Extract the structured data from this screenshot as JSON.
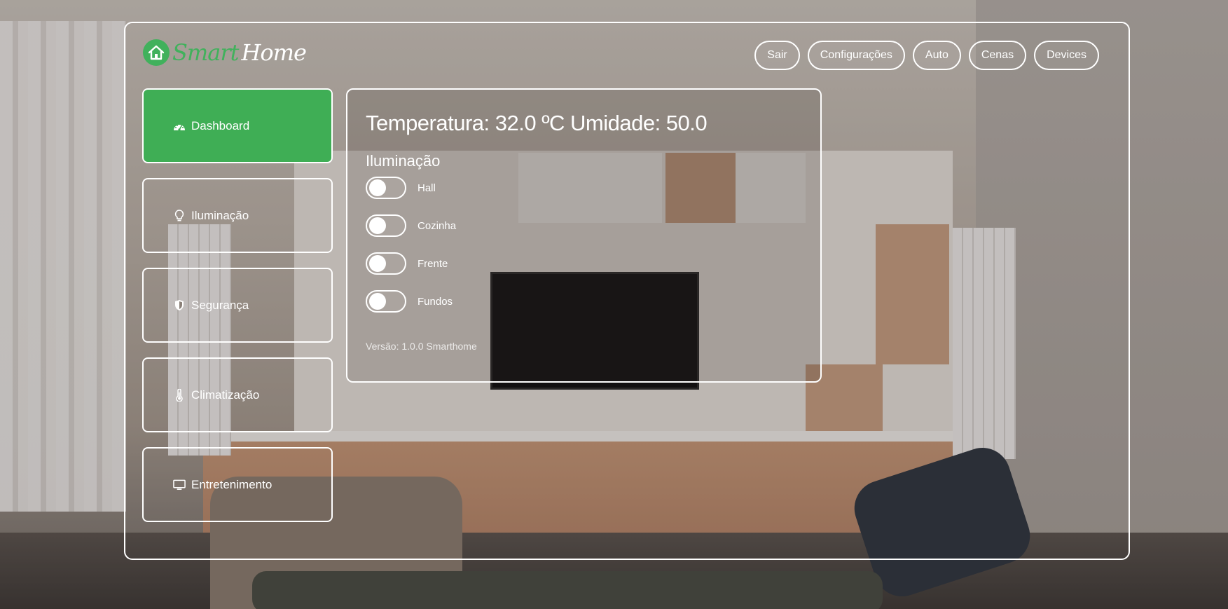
{
  "brand": {
    "smart": "Smart",
    "home": "Home",
    "icon": "house-icon",
    "accent": "#41b15c"
  },
  "topnav": {
    "items": [
      {
        "label": "Sair"
      },
      {
        "label": "Configurações"
      },
      {
        "label": "Auto"
      },
      {
        "label": "Cenas"
      },
      {
        "label": "Devices"
      }
    ]
  },
  "sidebar": {
    "items": [
      {
        "label": "Dashboard",
        "icon": "speedometer-icon",
        "active": true
      },
      {
        "label": "Iluminação",
        "icon": "lightbulb-icon"
      },
      {
        "label": "Segurança",
        "icon": "shield-icon"
      },
      {
        "label": "Climatização",
        "icon": "thermometer-icon"
      },
      {
        "label": "Entretenimento",
        "icon": "monitor-icon"
      }
    ]
  },
  "main": {
    "headline": "Temperatura: 32.0 ºC Umidade: 50.0",
    "lighting_title": "Iluminação",
    "lights": [
      {
        "label": "Hall",
        "on": false
      },
      {
        "label": "Cozinha",
        "on": false
      },
      {
        "label": "Frente",
        "on": false
      },
      {
        "label": "Fundos",
        "on": false
      }
    ],
    "version": "Versão: 1.0.0 Smarthome"
  },
  "colors": {
    "active": "#3fae55",
    "frame": "#ffffff"
  }
}
